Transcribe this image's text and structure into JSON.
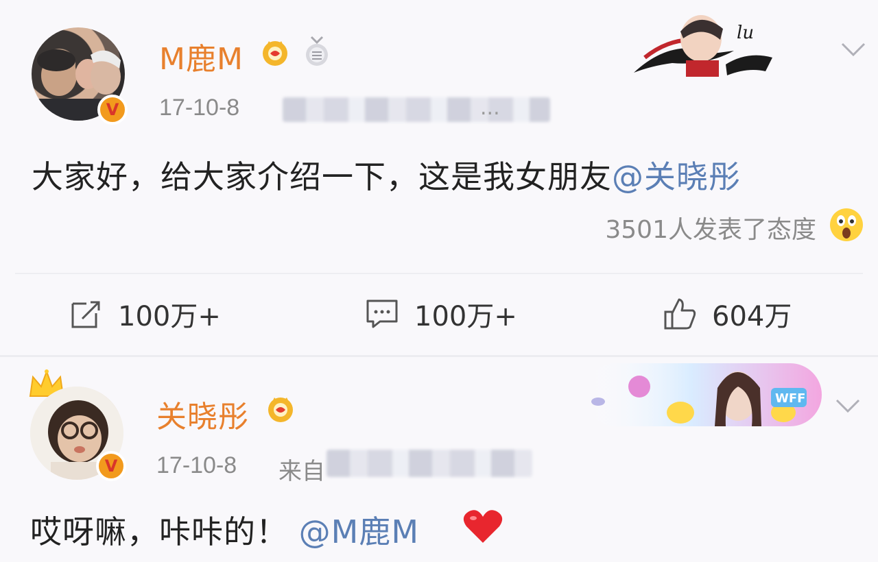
{
  "post1": {
    "username": "M鹿M",
    "date": "17-10-8",
    "source_suffix": "...",
    "content_text": "大家好，给大家介绍一下，这是我女朋友",
    "content_mention": "@关晓彤",
    "reactions_text": "3501人发表了态度",
    "actions": {
      "repost_count": "100万+",
      "comment_count": "100万+",
      "like_count": "604万"
    },
    "icons": [
      "avatar",
      "verified-v-icon",
      "vip-crown-icon",
      "medal-icon",
      "card-decoration",
      "chevron-down-icon",
      "wow-emoji-icon",
      "repost-icon",
      "comment-icon",
      "like-icon"
    ]
  },
  "post2": {
    "username": "关晓彤",
    "date": "17-10-8",
    "source_label": "来自",
    "content_text": "哎呀嘛，咔咔的！",
    "content_mention": "@M鹿M",
    "icons": [
      "crown-top-icon",
      "avatar",
      "verified-v-icon",
      "vip-crown-icon",
      "card-decoration",
      "chevron-down-icon",
      "heart-icon"
    ]
  },
  "colors": {
    "username": "#e8802d",
    "mention": "#5b7fb5",
    "meta": "#8a8a8a",
    "badge": "#f29a1d"
  }
}
